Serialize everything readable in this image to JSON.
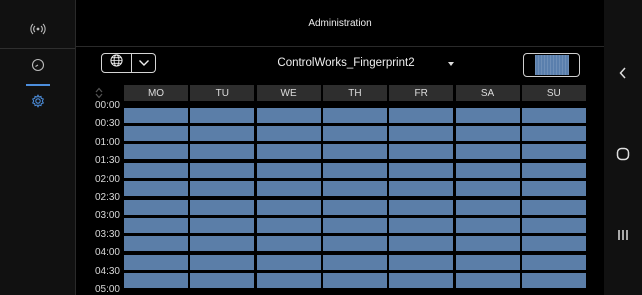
{
  "title": "Administration",
  "left_rail": {
    "items": [
      {
        "icon": "wireless-signal-icon",
        "active": false
      },
      {
        "icon": "clock-icon",
        "active": false
      },
      {
        "icon": "gear-icon",
        "active": true
      }
    ]
  },
  "toolbar": {
    "globe_icon": "globe-icon",
    "dropdown_icon": "chevron-down-icon",
    "profile_name": "ControlWorks_Fingerprint2",
    "swatch_color": "#5a7fad"
  },
  "schedule": {
    "days": [
      "MO",
      "TU",
      "WE",
      "TH",
      "FR",
      "SA",
      "SU"
    ],
    "times": [
      "00:00",
      "00:30",
      "01:00",
      "01:30",
      "02:00",
      "02:30",
      "03:00",
      "03:30",
      "04:00",
      "04:30",
      "05:00"
    ],
    "cell_color": "#5b7ea8",
    "header_bg": "#2e2e2e"
  },
  "nav_bar": {
    "back_icon": "chevron-left-icon",
    "home_icon": "circle-home-icon",
    "recents_icon": "recents-icon"
  }
}
